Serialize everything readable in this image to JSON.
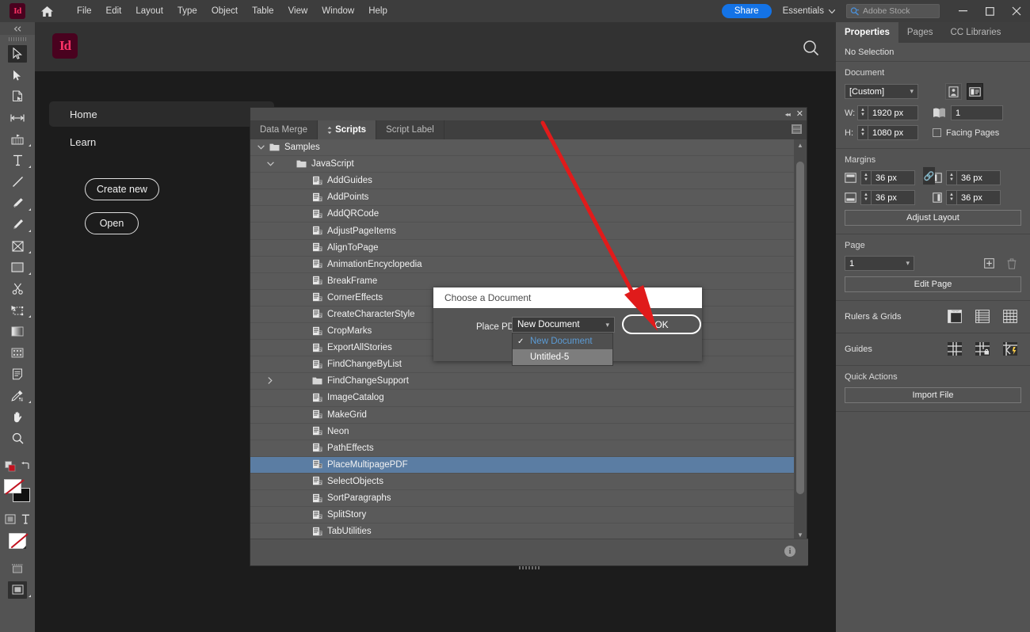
{
  "app": {
    "name": "Adobe InDesign",
    "logo_text": "Id"
  },
  "menubar": {
    "home_icon": "home-icon",
    "items": [
      "File",
      "Edit",
      "Layout",
      "Type",
      "Object",
      "Table",
      "View",
      "Window",
      "Help"
    ],
    "share_label": "Share",
    "workspace_label": "Essentials",
    "stock_placeholder": "Adobe Stock",
    "stock_icon": "stock-search-icon",
    "window_minimize": "–",
    "window_maximize": "❐",
    "window_close": "✕",
    "accent_blue": "#1473e6"
  },
  "toolbar": {
    "collapse_icon": "collapse-arrows-icon",
    "tools": [
      {
        "name": "selection-tool",
        "glyph": "arrow-outline-icon",
        "flyout": false,
        "active": true
      },
      {
        "name": "direct-selection-tool",
        "glyph": "arrow-solid-icon",
        "flyout": false,
        "active": false
      },
      {
        "name": "page-tool",
        "glyph": "page-icon",
        "flyout": false,
        "active": false
      },
      {
        "name": "gap-tool",
        "glyph": "gap-icon",
        "flyout": false,
        "active": false
      },
      {
        "name": "content-collector-tool",
        "glyph": "content-collector-icon",
        "flyout": true,
        "active": false
      },
      {
        "name": "type-tool",
        "glyph": "type-T-icon",
        "flyout": true,
        "active": false
      },
      {
        "name": "line-tool",
        "glyph": "line-icon",
        "flyout": false,
        "active": false
      },
      {
        "name": "pen-tool",
        "glyph": "pen-icon",
        "flyout": true,
        "active": false
      },
      {
        "name": "pencil-tool",
        "glyph": "pencil-icon",
        "flyout": true,
        "active": false
      },
      {
        "name": "frame-tool",
        "glyph": "frame-x-icon",
        "flyout": true,
        "active": false
      },
      {
        "name": "rectangle-tool",
        "glyph": "rectangle-icon",
        "flyout": true,
        "active": false
      },
      {
        "name": "scissors-tool",
        "glyph": "scissors-icon",
        "flyout": false,
        "active": false
      },
      {
        "name": "free-transform-tool",
        "glyph": "free-transform-icon",
        "flyout": true,
        "active": false
      },
      {
        "name": "gradient-swatch-tool",
        "glyph": "gradient-icon",
        "flyout": false,
        "active": false
      },
      {
        "name": "gradient-feather-tool",
        "glyph": "gradient-feather-icon",
        "flyout": false,
        "active": false
      },
      {
        "name": "note-tool",
        "glyph": "note-icon",
        "flyout": false,
        "active": false
      },
      {
        "name": "color-theme-tool",
        "glyph": "eyedropper-icon",
        "flyout": true,
        "active": false
      },
      {
        "name": "hand-tool",
        "glyph": "hand-icon",
        "flyout": false,
        "active": false
      },
      {
        "name": "zoom-tool",
        "glyph": "magnifier-icon",
        "flyout": false,
        "active": false
      }
    ],
    "fill_stroke": {
      "fill": "none-icon",
      "stroke": "black",
      "swap_icon": "swap-arrow-icon"
    },
    "formatting_affects": [
      "formatting-container-icon",
      "formatting-text-icon"
    ],
    "apply_none_icon": "apply-none-icon",
    "view_modes": [
      "normal-view-icon",
      "preview-view-icon"
    ]
  },
  "home": {
    "logo_text": "Id",
    "search_icon": "search-icon",
    "nav": [
      {
        "label": "Home",
        "selected": true
      },
      {
        "label": "Learn",
        "selected": false
      }
    ],
    "buttons": [
      {
        "label": "Create new"
      },
      {
        "label": "Open"
      }
    ]
  },
  "scripts_panel": {
    "titlebar": {
      "collapse_icon": "double-arrow-icon",
      "close_icon": "close-icon"
    },
    "tabs": [
      {
        "label": "Data Merge",
        "active": false
      },
      {
        "label": "Scripts",
        "active": true,
        "has_grip": true
      },
      {
        "label": "Script Label",
        "active": false
      }
    ],
    "panel_menu_icon": "panel-menu-icon",
    "info_icon": "info-icon",
    "scrollbar": {
      "up_icon": "chevron-up-icon",
      "down_icon": "chevron-down-icon"
    },
    "rows": [
      {
        "label": "Samples",
        "type": "folder",
        "indent": 0,
        "twisty": "down",
        "selected": false
      },
      {
        "label": "JavaScript",
        "type": "folder",
        "indent": 1,
        "twisty": "down",
        "selected": false
      },
      {
        "label": "AddGuides",
        "type": "script",
        "indent": 2,
        "twisty": "",
        "selected": false
      },
      {
        "label": "AddPoints",
        "type": "script",
        "indent": 2,
        "twisty": "",
        "selected": false
      },
      {
        "label": "AddQRCode",
        "type": "script",
        "indent": 2,
        "twisty": "",
        "selected": false
      },
      {
        "label": "AdjustPageItems",
        "type": "script",
        "indent": 2,
        "twisty": "",
        "selected": false
      },
      {
        "label": "AlignToPage",
        "type": "script",
        "indent": 2,
        "twisty": "",
        "selected": false
      },
      {
        "label": "AnimationEncyclopedia",
        "type": "script",
        "indent": 2,
        "twisty": "",
        "selected": false
      },
      {
        "label": "BreakFrame",
        "type": "script",
        "indent": 2,
        "twisty": "",
        "selected": false
      },
      {
        "label": "CornerEffects",
        "type": "script",
        "indent": 2,
        "twisty": "",
        "selected": false
      },
      {
        "label": "CreateCharacterStyle",
        "type": "script",
        "indent": 2,
        "twisty": "",
        "selected": false
      },
      {
        "label": "CropMarks",
        "type": "script",
        "indent": 2,
        "twisty": "",
        "selected": false
      },
      {
        "label": "ExportAllStories",
        "type": "script",
        "indent": 2,
        "twisty": "",
        "selected": false
      },
      {
        "label": "FindChangeByList",
        "type": "script",
        "indent": 2,
        "twisty": "",
        "selected": false
      },
      {
        "label": "FindChangeSupport",
        "type": "folder",
        "indent": 2,
        "twisty": "right",
        "selected": false
      },
      {
        "label": "ImageCatalog",
        "type": "script",
        "indent": 2,
        "twisty": "",
        "selected": false
      },
      {
        "label": "MakeGrid",
        "type": "script",
        "indent": 2,
        "twisty": "",
        "selected": false
      },
      {
        "label": "Neon",
        "type": "script",
        "indent": 2,
        "twisty": "",
        "selected": false
      },
      {
        "label": "PathEffects",
        "type": "script",
        "indent": 2,
        "twisty": "",
        "selected": false
      },
      {
        "label": "PlaceMultipagePDF",
        "type": "script",
        "indent": 2,
        "twisty": "",
        "selected": true
      },
      {
        "label": "SelectObjects",
        "type": "script",
        "indent": 2,
        "twisty": "",
        "selected": false
      },
      {
        "label": "SortParagraphs",
        "type": "script",
        "indent": 2,
        "twisty": "",
        "selected": false
      },
      {
        "label": "SplitStory",
        "type": "script",
        "indent": 2,
        "twisty": "",
        "selected": false
      },
      {
        "label": "TabUtilities",
        "type": "script",
        "indent": 2,
        "twisty": "",
        "selected": false
      }
    ],
    "selection_color": "#5b7da3"
  },
  "dialog": {
    "title": "Choose a Document",
    "field_label": "Place PDF in:",
    "select_value": "New Document",
    "ok_label": "OK",
    "options": [
      {
        "label": "New Document",
        "checked": true
      },
      {
        "label": "Untitled-5",
        "checked": false
      }
    ],
    "checked_color": "#5b9bd5"
  },
  "annotation": {
    "arrow_color": "#e01b1b",
    "type": "arrow-pointing-to-ok-button"
  },
  "properties_panel": {
    "tabs": [
      {
        "label": "Properties",
        "active": true
      },
      {
        "label": "Pages",
        "active": false
      },
      {
        "label": "CC Libraries",
        "active": false
      }
    ],
    "selection_status": "No Selection",
    "document": {
      "header": "Document",
      "preset_value": "[Custom]",
      "orientation_icons": [
        "portrait-orientation-icon",
        "landscape-orientation-icon"
      ],
      "orientation_selected": "landscape-orientation-icon",
      "width_label": "W:",
      "width_value": "1920 px",
      "height_label": "H:",
      "height_value": "1080 px",
      "pages_icon": "pages-count-icon",
      "pages_value": "1",
      "facing_pages_label": "Facing Pages",
      "facing_pages_checked": false
    },
    "margins": {
      "header": "Margins",
      "top_icon": "margin-top-icon",
      "top_value": "36 px",
      "bottom_icon": "margin-bottom-icon",
      "bottom_value": "36 px",
      "left_icon": "margin-left-icon",
      "left_value": "36 px",
      "right_icon": "margin-right-icon",
      "right_value": "36 px",
      "link_icon": "link-chain-icon",
      "adjust_layout_label": "Adjust Layout"
    },
    "page": {
      "header": "Page",
      "value": "1",
      "add_icon": "add-page-icon",
      "delete_icon": "trash-icon",
      "edit_page_label": "Edit Page"
    },
    "rulers_grids": {
      "header": "Rulers & Grids",
      "icons": [
        "show-rulers-icon",
        "baseline-grid-icon",
        "document-grid-icon"
      ],
      "selected": "show-rulers-icon"
    },
    "guides": {
      "header": "Guides",
      "icons": [
        "show-guides-icon",
        "lock-guides-icon",
        "smart-guides-icon"
      ]
    },
    "quick_actions": {
      "header": "Quick Actions",
      "import_file_label": "Import File"
    }
  }
}
